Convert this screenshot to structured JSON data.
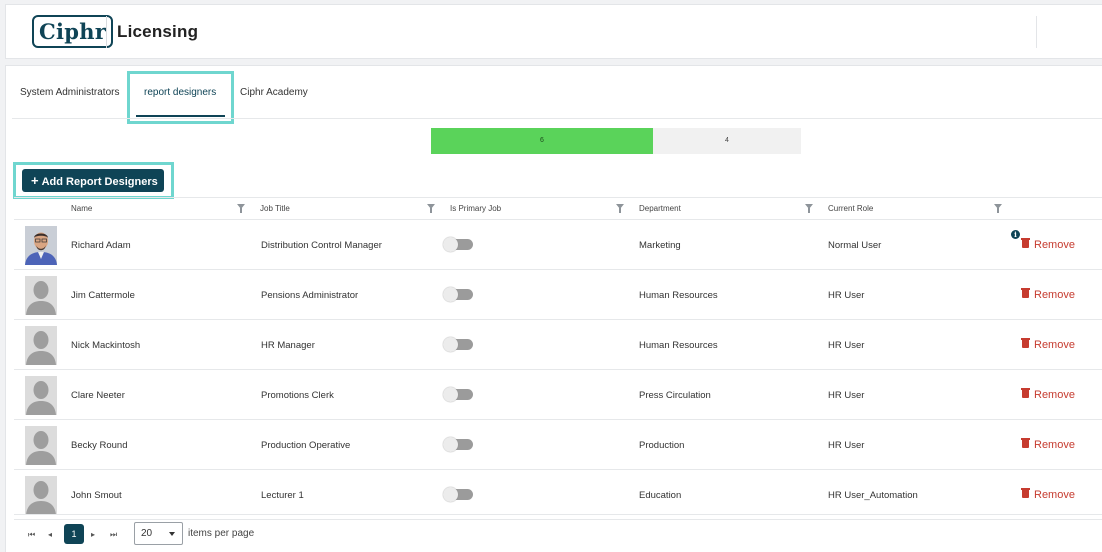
{
  "header": {
    "logo_text": "Ciphr",
    "title": "Licensing"
  },
  "tabs": [
    {
      "label": "System Administrators",
      "active": false
    },
    {
      "label": "report designers",
      "active": true
    },
    {
      "label": "Ciphr Academy",
      "active": false
    }
  ],
  "license_bar": {
    "used": "6",
    "remaining": "4",
    "used_fraction": 0.6,
    "used_color": "#5ad35a"
  },
  "toolbar": {
    "add_label": "Add Report Designers"
  },
  "columns": [
    "Name",
    "Job Title",
    "Is Primary Job",
    "Department",
    "Current Role"
  ],
  "rows": [
    {
      "name": "Richard Adam",
      "job_title": "Distribution Control Manager",
      "is_primary": false,
      "department": "Marketing",
      "role": "Normal User",
      "has_photo": true,
      "has_info": true
    },
    {
      "name": "Jim Cattermole",
      "job_title": "Pensions Administrator",
      "is_primary": false,
      "department": "Human Resources",
      "role": "HR User",
      "has_photo": false,
      "has_info": false
    },
    {
      "name": "Nick Mackintosh",
      "job_title": "HR Manager",
      "is_primary": false,
      "department": "Human Resources",
      "role": "HR User",
      "has_photo": false,
      "has_info": false
    },
    {
      "name": "Clare Neeter",
      "job_title": "Promotions Clerk",
      "is_primary": false,
      "department": "Press Circulation",
      "role": "HR User",
      "has_photo": false,
      "has_info": false
    },
    {
      "name": "Becky Round",
      "job_title": "Production Operative",
      "is_primary": false,
      "department": "Production",
      "role": "HR User",
      "has_photo": false,
      "has_info": false
    },
    {
      "name": "John Smout",
      "job_title": "Lecturer 1",
      "is_primary": false,
      "department": "Education",
      "role": "HR User_Automation",
      "has_photo": false,
      "has_info": false
    }
  ],
  "row_action": {
    "remove_label": "Remove",
    "info_glyph": "i"
  },
  "pager": {
    "first": "⏮",
    "prev": "◂",
    "current_page": "1",
    "next": "▸",
    "last": "⏭",
    "page_size": "20",
    "page_size_label": "items per page"
  },
  "colors": {
    "brand": "#0f4456",
    "remove": "#c63b2f",
    "highlight": "#6fd6cf"
  }
}
